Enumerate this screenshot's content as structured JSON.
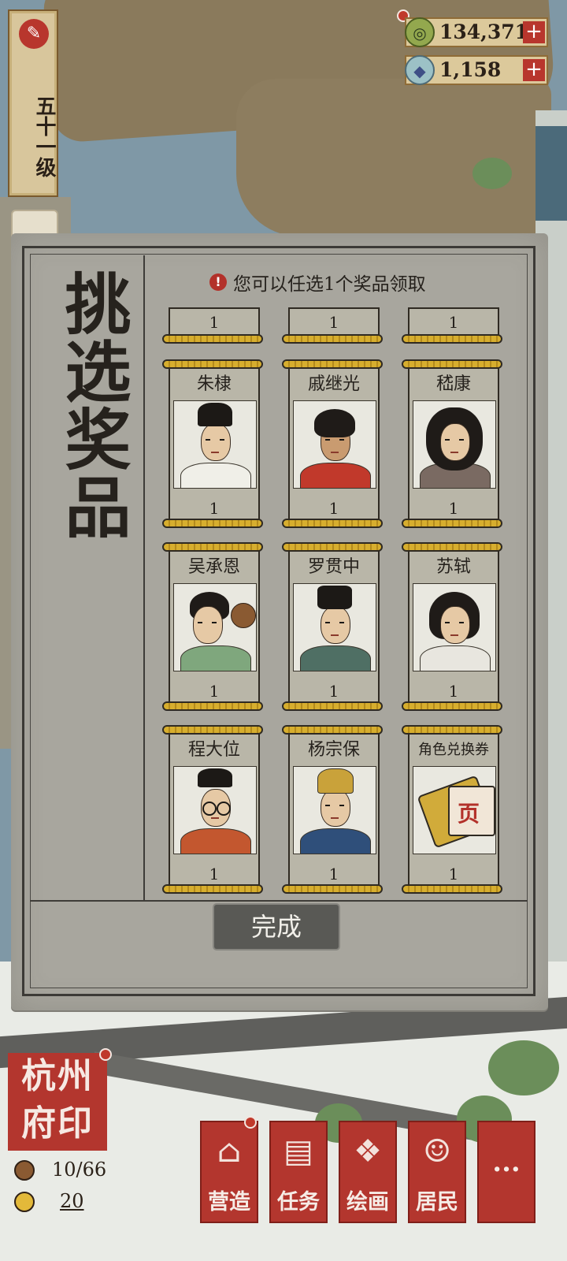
{
  "hud": {
    "level_text": "五十一级",
    "coins": "134,371",
    "gems": "1,158",
    "plus": "+",
    "coin_icon": "coin-icon",
    "gem_icon": "gem-icon"
  },
  "panel": {
    "title": "挑选奖品",
    "notice_icon": "!",
    "notice": "您可以任选1个奖品领取",
    "top_row_qty": [
      "1",
      "1",
      "1"
    ],
    "cards": [
      {
        "name": "朱棣",
        "qty": "1"
      },
      {
        "name": "戚继光",
        "qty": "1"
      },
      {
        "name": "嵇康",
        "qty": "1"
      },
      {
        "name": "吴承恩",
        "qty": "1"
      },
      {
        "name": "罗贯中",
        "qty": "1"
      },
      {
        "name": "苏轼",
        "qty": "1"
      },
      {
        "name": "程大位",
        "qty": "1"
      },
      {
        "name": "杨宗保",
        "qty": "1"
      },
      {
        "name": "角色兑换券",
        "qty": "1"
      }
    ],
    "ticket_glyph": "页",
    "done": "完成"
  },
  "bottom": {
    "seal_text": "杭州府印",
    "population": "10/66",
    "citizens": "20",
    "nav": [
      {
        "label": "营造",
        "icon": "build-icon"
      },
      {
        "label": "任务",
        "icon": "task-book-icon"
      },
      {
        "label": "绘画",
        "icon": "scroll-painting-icon"
      },
      {
        "label": "居民",
        "icon": "resident-icon"
      },
      {
        "label": "···",
        "icon": "more-icon"
      }
    ]
  },
  "colors": {
    "accent_red": "#b3362e",
    "gold": "#d7ae2e",
    "panel": "#a8a69e",
    "button": "#595955"
  }
}
